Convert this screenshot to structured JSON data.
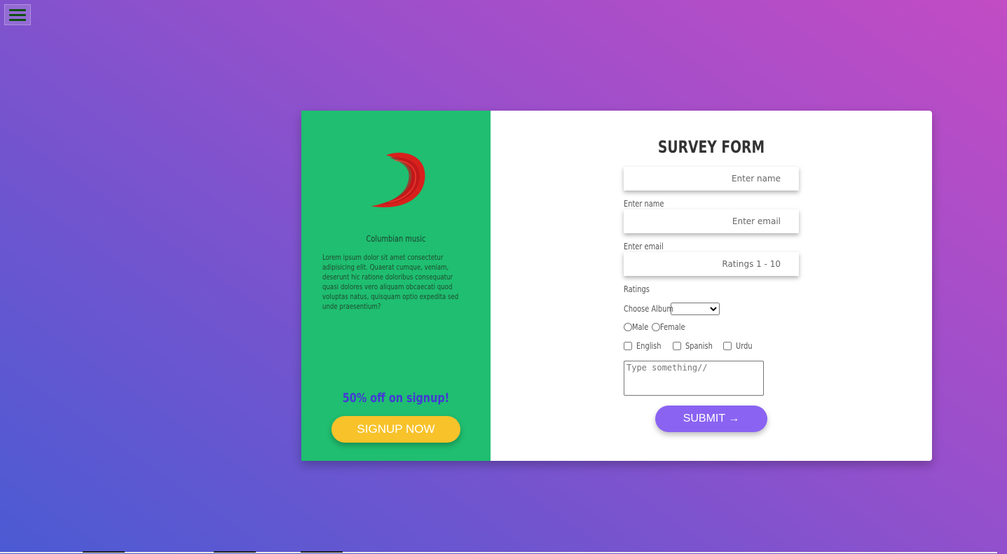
{
  "nav": {
    "menu_icon": "hamburger-menu-icon"
  },
  "sidebar": {
    "logo_icon": "red-brush-stroke-logo",
    "brand_name": "Columbian music",
    "description": "Lorem ipsum dolor sit amet consectetur adipisicing elit. Quaerat cumque, veniam, deserunt hic ratione doloribus consequatur quasi dolores vero aliquam obcaecati quod voluptas natus, quisquam optio expedita sed unde praesentium?",
    "promo": "50% off on signup!",
    "signup_label": "SIGNUP NOW"
  },
  "form": {
    "title": "SURVEY FORM",
    "name_placeholder": "Enter name",
    "name_label": "Enter name",
    "email_placeholder": "Enter email",
    "email_label": "Enter email",
    "ratings_placeholder": "Ratings 1 - 10",
    "ratings_label": "Ratings",
    "album_label": "Choose Album",
    "album_selected": "",
    "gender_options": [
      "Male",
      "Female"
    ],
    "languages": [
      "English",
      "Spanish",
      "Urdu"
    ],
    "comment_placeholder": "Type something//",
    "submit_label": "SUBMIT →"
  },
  "colors": {
    "sidebar_bg": "#1fbe70",
    "signup_button": "#f8c22a",
    "submit_button": "#8a63f2",
    "promo_text": "#4438d6",
    "logo": "#d8201c"
  }
}
